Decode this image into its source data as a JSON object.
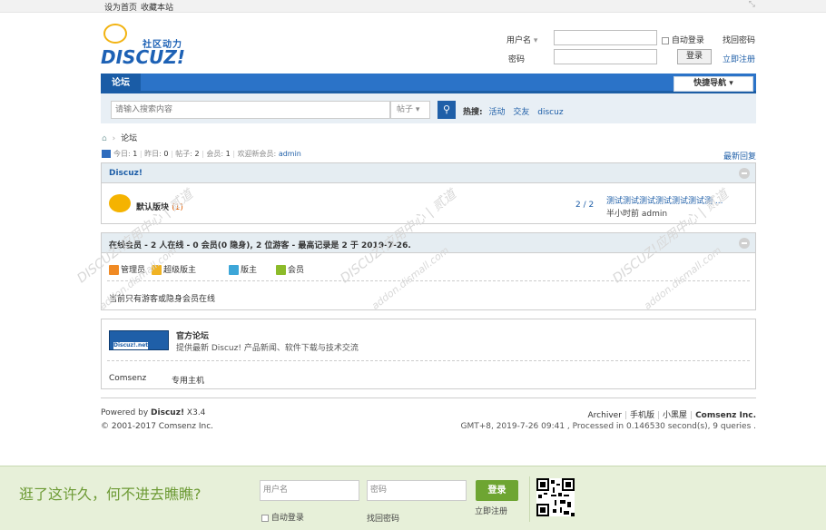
{
  "topbar": {
    "set_home": "设为首页",
    "bookmark": "收藏本站"
  },
  "logo": {
    "slogan": "社区动力",
    "wordmark": "DISCUZ!"
  },
  "login": {
    "username_label": "用户名",
    "password_label": "密码",
    "auto_login": "自动登录",
    "find_password": "找回密码",
    "login_button": "登录",
    "register_link": "立即注册"
  },
  "nav": {
    "forum": "论坛",
    "quick_nav": "快捷导航 ▾"
  },
  "search": {
    "placeholder": "请输入搜索内容",
    "type": "帖子 ▾",
    "hot_label": "热搜:",
    "hot_terms": [
      "活动",
      "交友",
      "discuz"
    ]
  },
  "breadcrumb": {
    "home_icon": "home-icon",
    "sep": "›",
    "current": "论坛"
  },
  "stats": {
    "today_label": "今日:",
    "today": "1",
    "yesterday_label": "昨日:",
    "yesterday": "0",
    "posts_label": "帖子:",
    "posts": "2",
    "members_label": "会员:",
    "members": "1",
    "welcome_label": "欢迎新会员:",
    "newest": "admin",
    "latest_reply": "最新回复"
  },
  "forum": {
    "category": "Discuz!",
    "name": "默认版块",
    "today": "(1)",
    "count": "2 / 2",
    "last_post_title": "测试测试测试测试测试测试测 ...",
    "last_post_meta": "半小时前 admin"
  },
  "online": {
    "title": "在线会员 - 2 人在线 - 0 会员(0 隐身), 2 位游客 - 最高记录是 2 于 2019-7-26.",
    "legend": [
      {
        "label": "管理员",
        "color": "#f08a24"
      },
      {
        "label": "超级版主",
        "color": "#f0b324"
      },
      {
        "label": "版主",
        "color": "#3da6d8"
      },
      {
        "label": "会员",
        "color": "#8cbb2a"
      }
    ],
    "note": "当前只有游客或隐身会员在线"
  },
  "links": {
    "partner_badge": "Discuz!.net",
    "partner_name": "官方论坛",
    "partner_desc": "提供最新 Discuz! 产品新闻、软件下载与技术交流",
    "text_links": [
      "Comsenz",
      "专用主机"
    ]
  },
  "footer": {
    "powered_prefix": "Powered by",
    "powered_product": "Discuz!",
    "powered_version": "X3.4",
    "copyright": "© 2001-2017 Comsenz Inc.",
    "links": [
      "Archiver",
      "手机版",
      "小黑屋"
    ],
    "company": "Comsenz Inc.",
    "gmt": "GMT+8, 2019-7-26 09:41 , Processed in 0.146530 second(s), 9 queries ."
  },
  "promo": {
    "text": "逛了这许久，何不进去瞧瞧?",
    "username_placeholder": "用户名",
    "password_placeholder": "密码",
    "auto_login": "自动登录",
    "find_password": "找回密码",
    "login_button": "登录",
    "register": "立即注册"
  },
  "watermark": {
    "text": "DISCUZ!应用中心 | 贰道",
    "domain": "addon.dismall.com"
  }
}
